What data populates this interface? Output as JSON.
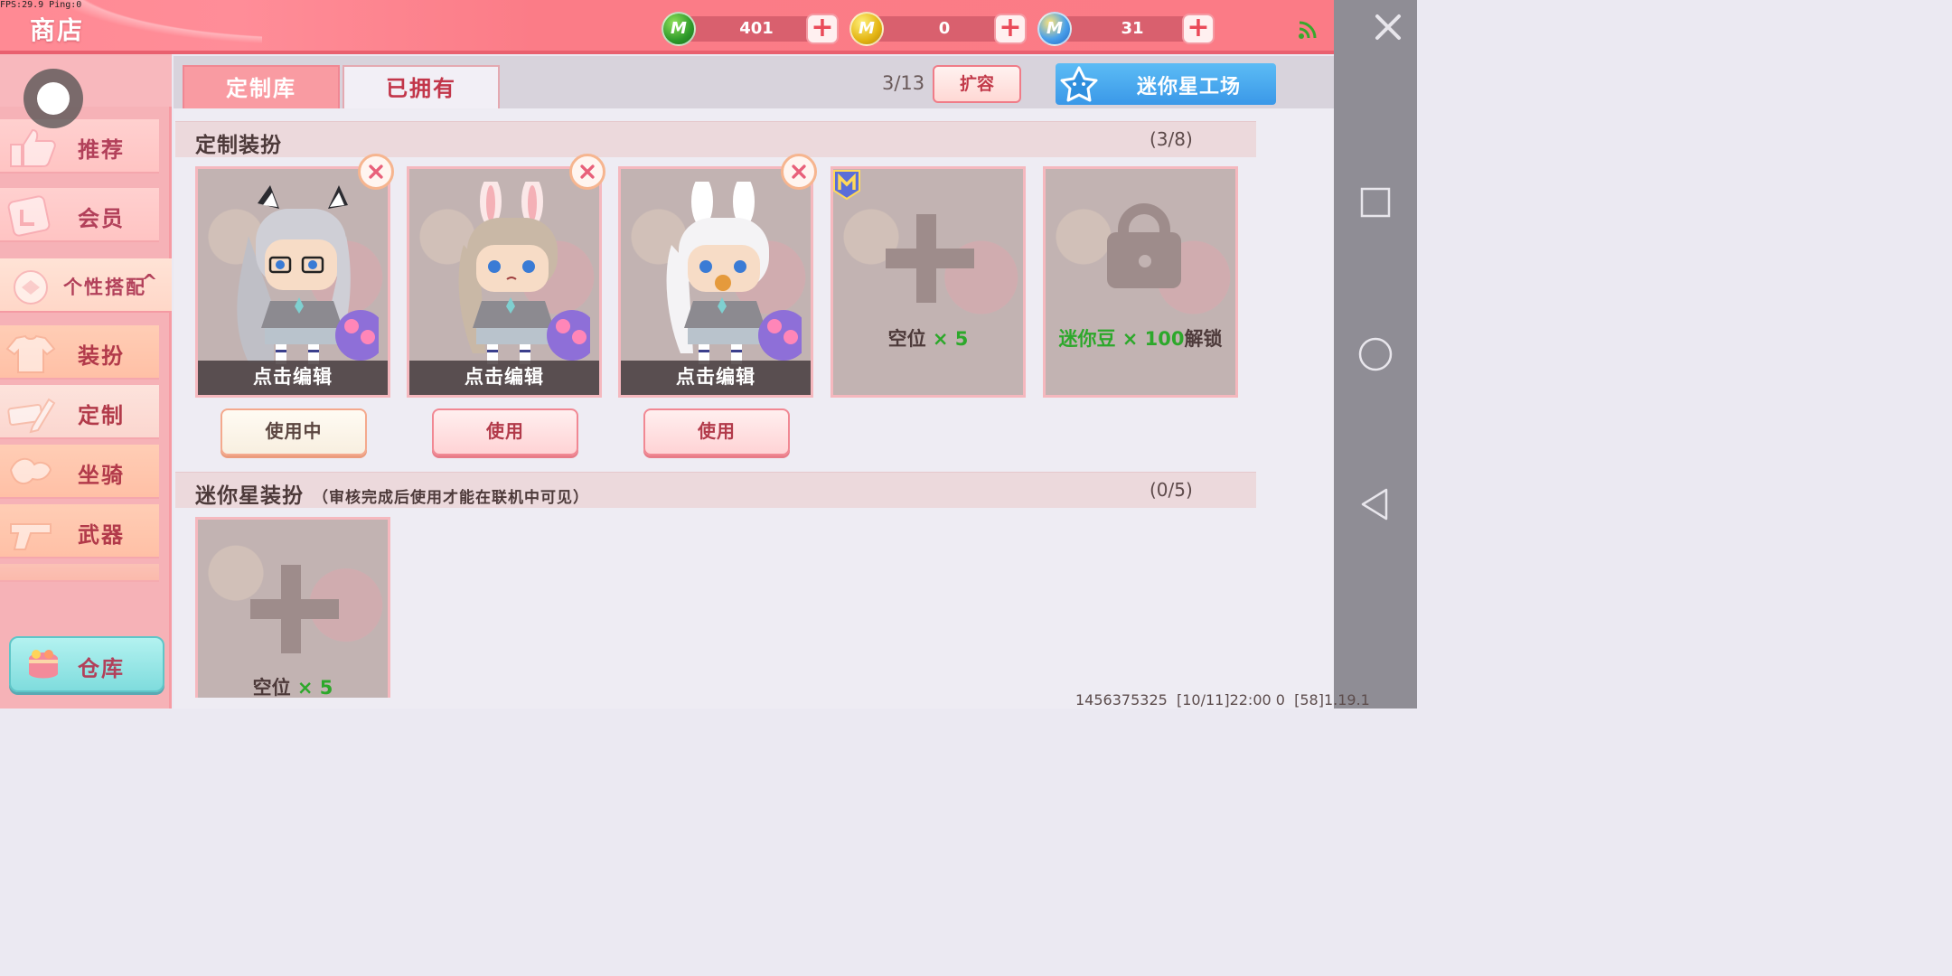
{
  "fps": "FPS:29.9 Ping:0",
  "header": {
    "title": "商店",
    "currencies": [
      {
        "name": "green-mini-coin",
        "amount": "401",
        "color": "#2e9a2a"
      },
      {
        "name": "gold-mini-coin",
        "amount": "0",
        "color": "#e3b412"
      },
      {
        "name": "mini-bean",
        "amount": "31",
        "color": "#4aa0ea"
      }
    ]
  },
  "sidebar": {
    "items": [
      {
        "label": "推荐",
        "icon": "thumbs-up-icon"
      },
      {
        "label": "会员",
        "icon": "vip-card-icon"
      },
      {
        "label": "个性搭配",
        "icon": "style-icon",
        "expanded": true
      },
      {
        "label": "装扮",
        "icon": "shirt-icon"
      },
      {
        "label": "定制",
        "icon": "pencil-ruler-icon",
        "active": true
      },
      {
        "label": "坐骑",
        "icon": "saddle-icon"
      },
      {
        "label": "武器",
        "icon": "revolver-icon"
      }
    ],
    "warehouse": "仓库"
  },
  "tabs": [
    {
      "label": "定制库",
      "active": false
    },
    {
      "label": "已拥有",
      "active": true
    }
  ],
  "capacity": "3/13",
  "expand_label": "扩容",
  "workshop_label": "迷你星工场",
  "custom_section": {
    "title": "定制装扮",
    "count": "(3/8)",
    "cards": [
      {
        "edit_label": "点击编辑",
        "button": "使用中",
        "in_use": true,
        "ears": "cat",
        "hair": "#c9c9cf"
      },
      {
        "edit_label": "点击编辑",
        "button": "使用",
        "in_use": false,
        "ears": "bunny",
        "hair": "#c9b8a6"
      },
      {
        "edit_label": "点击编辑",
        "button": "使用",
        "in_use": false,
        "ears": "bunny",
        "hair": "#f4f3f5"
      }
    ],
    "empty_slot": {
      "text": "空位",
      "times": "× 5"
    },
    "locked_slot": {
      "cost": "迷你豆 × 100",
      "unlock": "解锁"
    }
  },
  "mini_star_section": {
    "title": "迷你星装扮",
    "note": "（审核完成后使用才能在联机中可见）",
    "count": "(0/5)",
    "empty_slot": {
      "text": "空位",
      "times": "× 5"
    }
  },
  "footer": {
    "uid": "1456375325",
    "time": "[10/11]22:00 0",
    "version": "[58]1.19.1"
  }
}
